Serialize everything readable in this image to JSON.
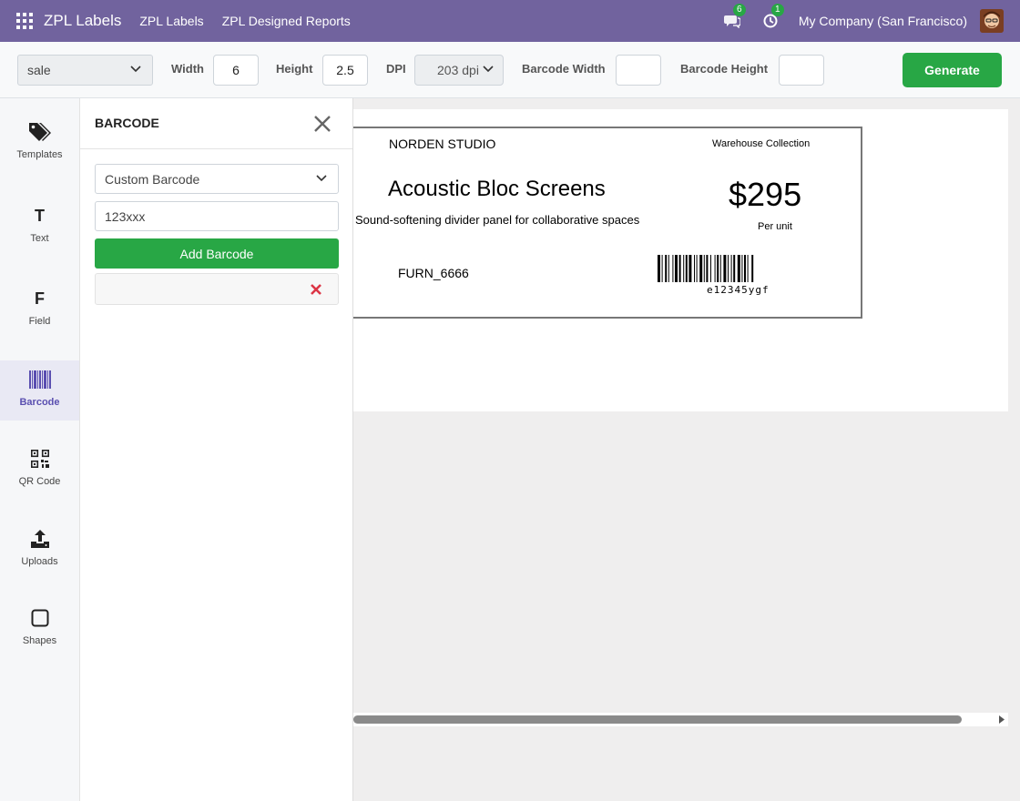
{
  "navbar": {
    "brand": "ZPL Labels",
    "links": [
      "ZPL Labels",
      "ZPL Designed Reports"
    ],
    "messages_count": "6",
    "activities_count": "1",
    "company": "My Company (San Francisco)"
  },
  "toolbar": {
    "model_select": "sale",
    "width_label": "Width",
    "width_value": "6",
    "height_label": "Height",
    "height_value": "2.5",
    "dpi_label": "DPI",
    "dpi_value": "203 dpi",
    "barcode_width_label": "Barcode Width",
    "barcode_width_value": "",
    "barcode_height_label": "Barcode Height",
    "barcode_height_value": "",
    "generate_label": "Generate"
  },
  "sidebar": {
    "items": [
      {
        "label": "Templates",
        "icon": "tags-icon"
      },
      {
        "label": "Text",
        "icon": "text-icon"
      },
      {
        "label": "Field",
        "icon": "field-icon"
      },
      {
        "label": "Barcode",
        "icon": "barcode-icon",
        "active": true
      },
      {
        "label": "QR Code",
        "icon": "qr-code-icon"
      },
      {
        "label": "Uploads",
        "icon": "upload-icon"
      },
      {
        "label": "Shapes",
        "icon": "square-icon"
      }
    ]
  },
  "panel": {
    "title": "BARCODE",
    "type_select": "Custom Barcode",
    "value_input": "123xxx",
    "add_button": "Add Barcode"
  },
  "label": {
    "brand": "NORDEN STUDIO",
    "collection": "Warehouse Collection",
    "product_name": "Acoustic Bloc Screens",
    "description": "Sound-softening divider panel for collaborative spaces",
    "price": "$295",
    "price_unit": "Per unit",
    "sku": "FURN_6666",
    "barcode_text": "e12345ygf"
  },
  "colors": {
    "navbar": "#71639e",
    "accent_green": "#28a745",
    "active_sidebar": "#5a4fb0",
    "remove_red": "#dc3545"
  }
}
